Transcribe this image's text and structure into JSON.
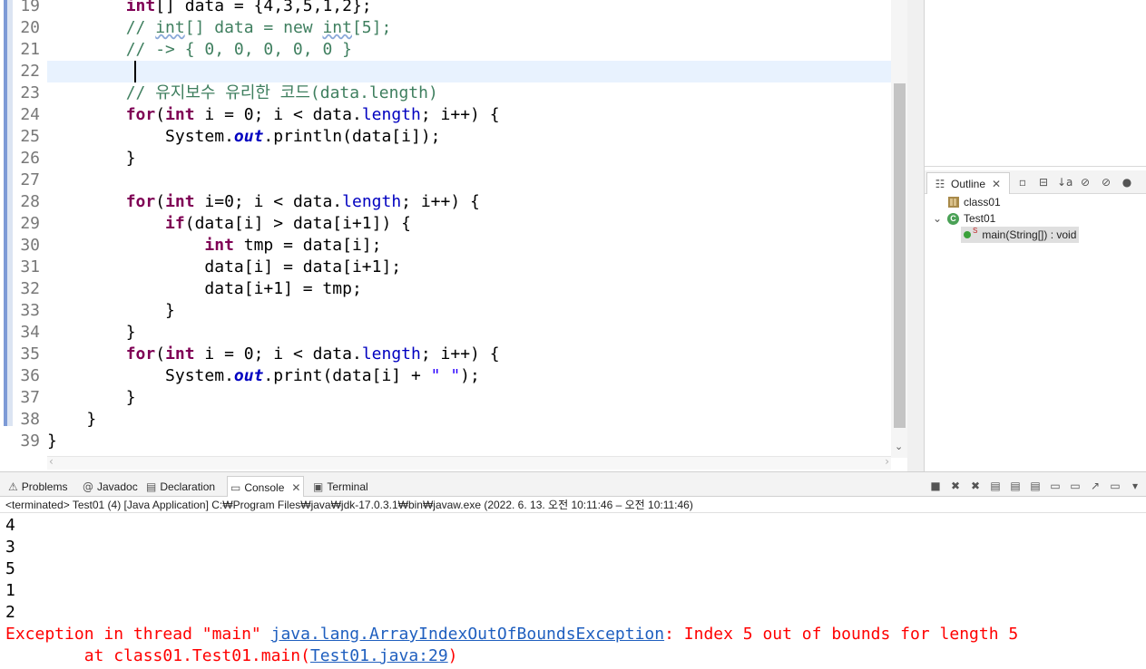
{
  "editor": {
    "lines": [
      {
        "n": "19",
        "html": "        <span class=\"kw\">int</span>[] data = {4,3,5,1,2};"
      },
      {
        "n": "20",
        "html": "        <span class=\"cm\">// <span class=\"sq\">int</span>[] data = new <span class=\"sq\">int</span>[5];</span>"
      },
      {
        "n": "21",
        "html": "        <span class=\"cm\">// -&gt; { 0, 0, 0, 0, 0 }</span>"
      },
      {
        "n": "22",
        "html": ""
      },
      {
        "n": "23",
        "html": "        <span class=\"cm\">// 유지보수 유리한 코드(data.length)</span>"
      },
      {
        "n": "24",
        "html": "        <span class=\"kw\">for</span>(<span class=\"kw\">int</span> i = 0; i &lt; data.<span class=\"fld\">length</span>; i++) {"
      },
      {
        "n": "25",
        "html": "            System.<span class=\"st\">out</span>.println(data[i]);"
      },
      {
        "n": "26",
        "html": "        }"
      },
      {
        "n": "27",
        "html": ""
      },
      {
        "n": "28",
        "html": "        <span class=\"kw\">for</span>(<span class=\"kw\">int</span> i=0; i &lt; data.<span class=\"fld\">length</span>; i++) {"
      },
      {
        "n": "29",
        "html": "            <span class=\"kw\">if</span>(data[i] &gt; data[i+1]) {"
      },
      {
        "n": "30",
        "html": "                <span class=\"kw\">int</span> tmp = data[i];"
      },
      {
        "n": "31",
        "html": "                data[i] = data[i+1];"
      },
      {
        "n": "32",
        "html": "                data[i+1] = tmp;"
      },
      {
        "n": "33",
        "html": "            }"
      },
      {
        "n": "34",
        "html": "        }"
      },
      {
        "n": "35",
        "html": "        <span class=\"kw\">for</span>(<span class=\"kw\">int</span> i = 0; i &lt; data.<span class=\"fld\">length</span>; i++) {"
      },
      {
        "n": "36",
        "html": "            System.<span class=\"st\">out</span>.print(data[i] + <span class=\"str\">\" \"</span>);"
      },
      {
        "n": "37",
        "html": "        }"
      },
      {
        "n": "38",
        "html": "    }"
      },
      {
        "n": "39",
        "html": "}"
      }
    ],
    "current_line_index": 3
  },
  "outline": {
    "tab_label": "Outline",
    "tab_close": "✕",
    "nodes": [
      {
        "label": "class01",
        "icon": "package-icon"
      },
      {
        "label": "Test01",
        "icon": "class-icon",
        "expander": "⌄",
        "icon_glyph": "C"
      },
      {
        "label": "main(String[]) : void",
        "icon": "method-icon",
        "modifier": "S"
      }
    ],
    "toolbar_icons": [
      "▫",
      "⊟",
      "↓a",
      "⊘",
      "⊘",
      "●",
      "⋮"
    ]
  },
  "console": {
    "tabs": [
      {
        "label": "Problems",
        "icon": "⚠"
      },
      {
        "label": "Javadoc",
        "icon": "@"
      },
      {
        "label": "Declaration",
        "icon": "▤"
      },
      {
        "label": "Console",
        "icon": "▭",
        "close": "✕",
        "active": true
      },
      {
        "label": "Terminal",
        "icon": "▣"
      }
    ],
    "toolbar_icons": [
      "■",
      "✖",
      "✖",
      "▤",
      "▤",
      "▤",
      "▭",
      "▭",
      "↗",
      "▭",
      "▾"
    ],
    "status": "<terminated> Test01 (4) [Java Application] C:₩Program Files₩java₩jdk-17.0.3.1₩bin₩javaw.exe  (2022. 6. 13. 오전 10:11:46 – 오전 10:11:46)",
    "output": [
      "4",
      "3",
      "5",
      "1",
      "2"
    ],
    "exception": {
      "prefix": "Exception in thread \"main\" ",
      "link": "java.lang.ArrayIndexOutOfBoundsException",
      "suffix": ": Index 5 out of bounds for length 5",
      "at_prefix": "        at class01.Test01.main(",
      "at_link": "Test01.java:29",
      "at_suffix": ")"
    }
  }
}
